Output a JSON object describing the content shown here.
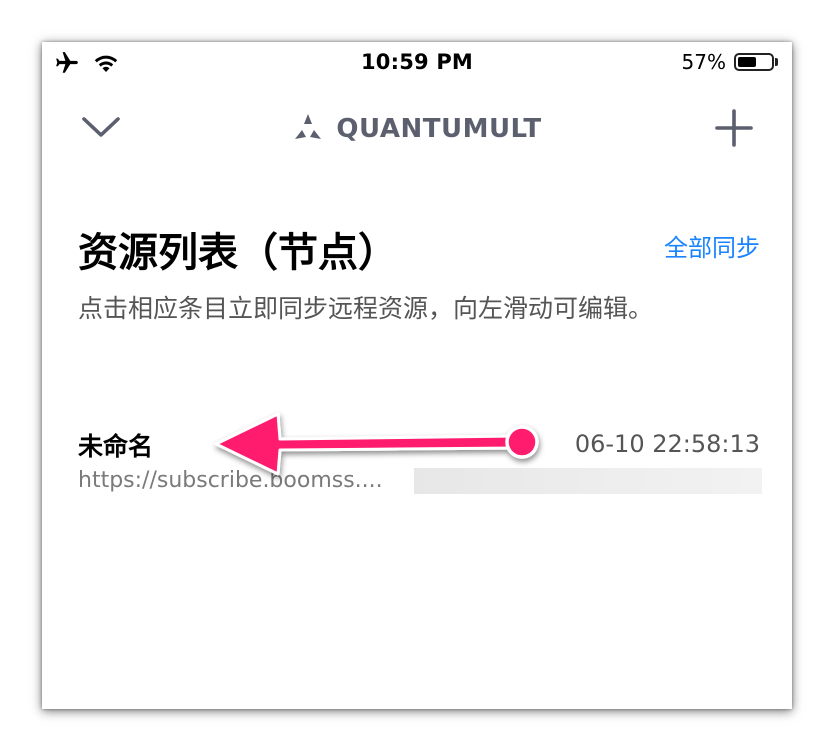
{
  "status_bar": {
    "time": "10:59 PM",
    "battery_percent_label": "57%",
    "battery_level": 0.57,
    "left_icons": [
      "airplane-icon",
      "wifi-icon"
    ]
  },
  "nav": {
    "app_title": "QUANTUMULT",
    "left_icon": "chevron-down-icon",
    "right_icon": "plus-icon",
    "logo_icon": "quantumult-logo-icon"
  },
  "header": {
    "title": "资源列表（节点）",
    "sync_all_label": "全部同步",
    "description": "点击相应条目立即同步远程资源，向左滑动可编辑。"
  },
  "resources": [
    {
      "name": "未命名",
      "url": "https://subscribe.boomss....",
      "updated": "06-10 22:58:13"
    }
  ],
  "colors": {
    "accent": "#1a84ff",
    "title_gray": "#5b5f6e",
    "annotation_pink": "#ff1f6e"
  }
}
